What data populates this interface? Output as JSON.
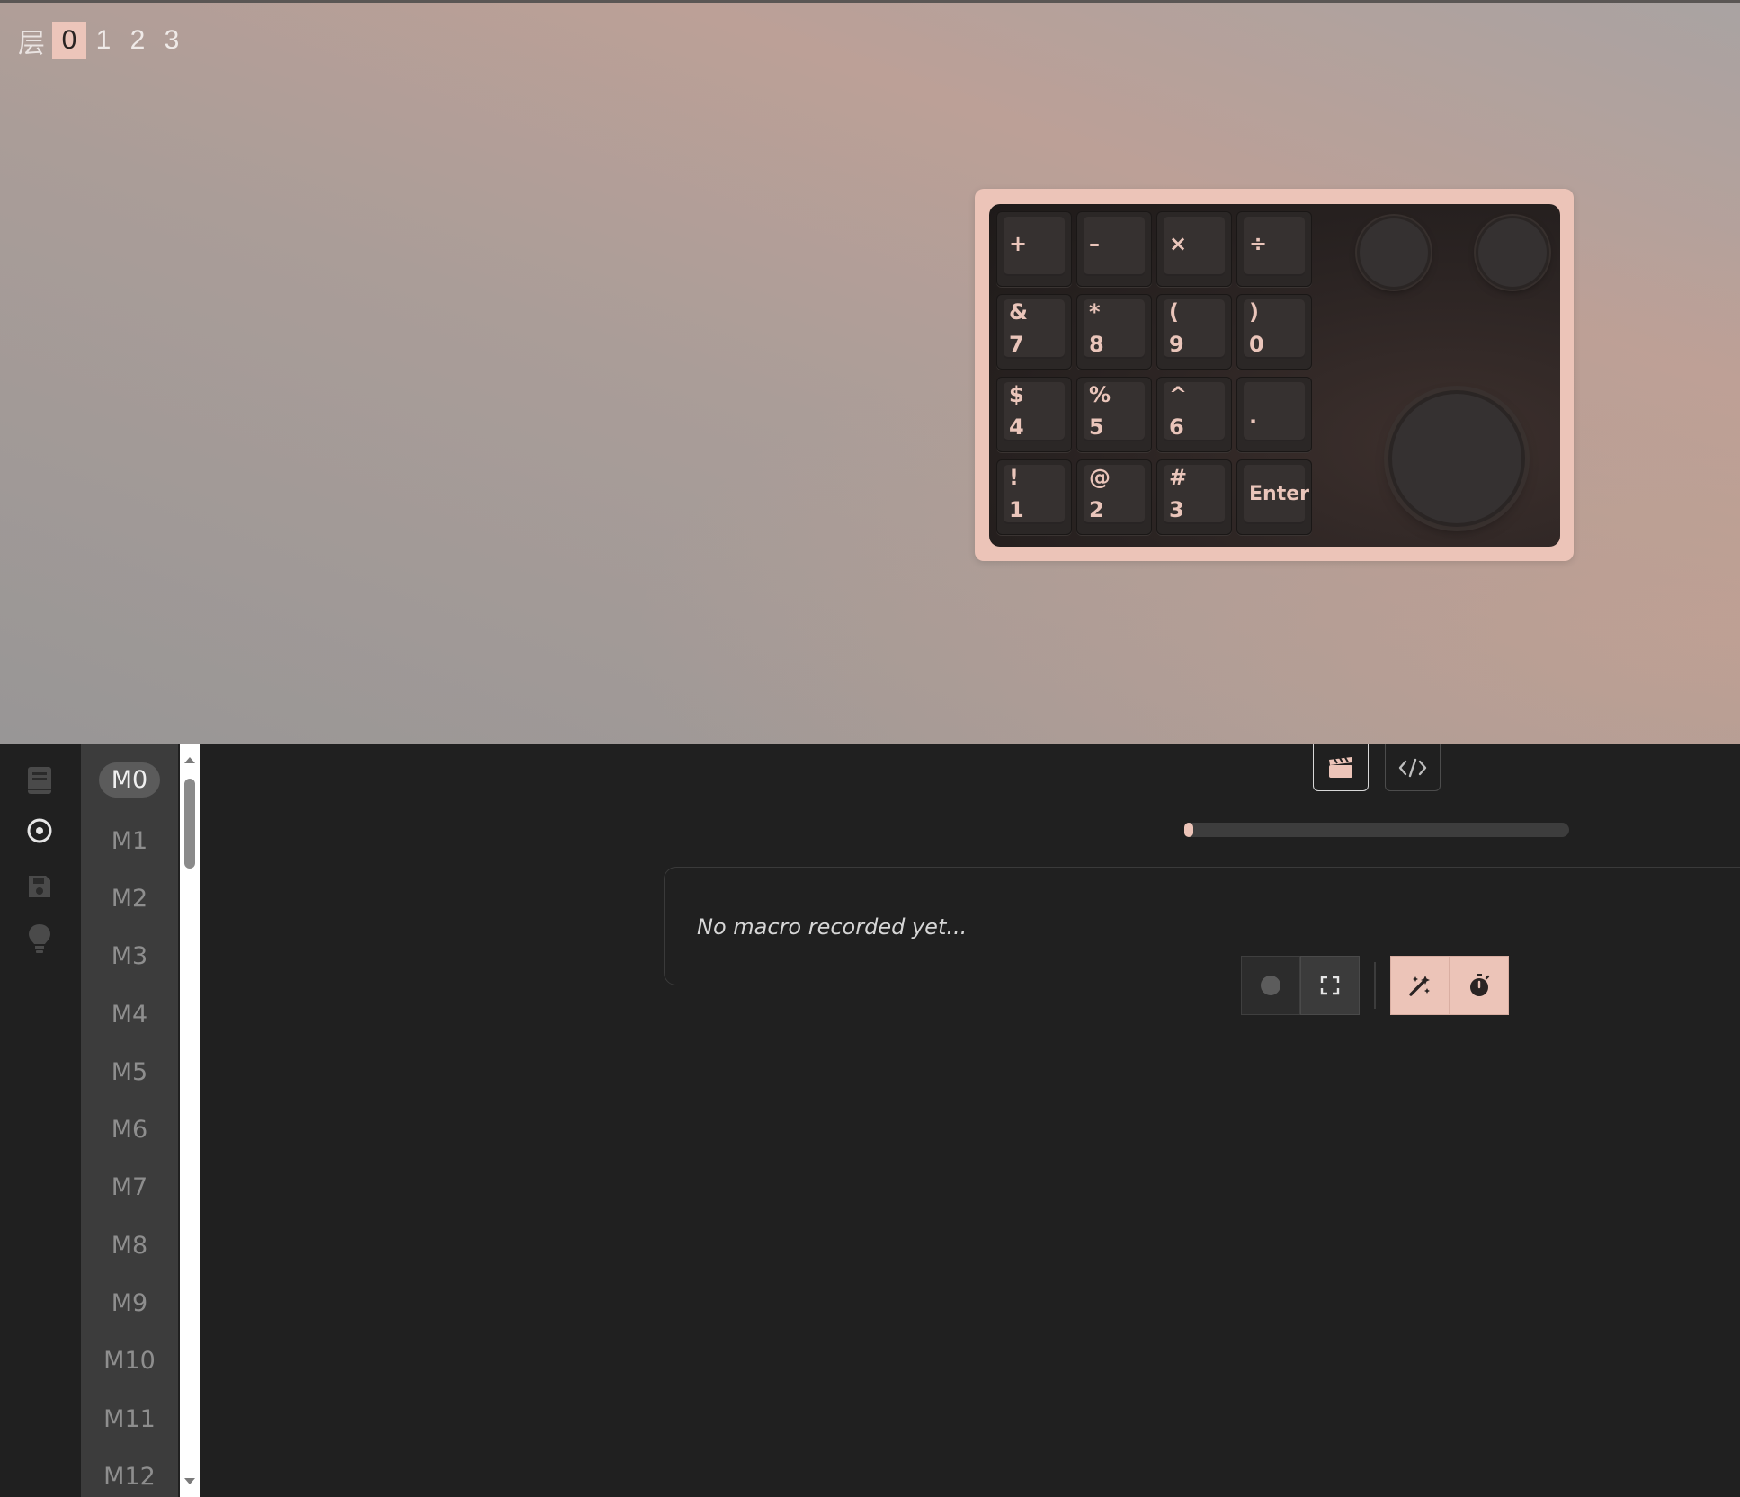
{
  "layers": {
    "label": "层",
    "items": [
      "0",
      "1",
      "2",
      "3"
    ],
    "active": "0"
  },
  "keyboard": {
    "rows": [
      [
        {
          "top": "+",
          "bottom": ""
        },
        {
          "top": "–",
          "bottom": ""
        },
        {
          "top": "×",
          "bottom": ""
        },
        {
          "top": "÷",
          "bottom": ""
        }
      ],
      [
        {
          "top": "&",
          "bottom": "7"
        },
        {
          "top": "*",
          "bottom": "8"
        },
        {
          "top": "(",
          "bottom": "9"
        },
        {
          "top": ")",
          "bottom": "0"
        }
      ],
      [
        {
          "top": "$",
          "bottom": "4"
        },
        {
          "top": "%",
          "bottom": "5"
        },
        {
          "top": "^",
          "bottom": "6"
        },
        {
          "top": "",
          "bottom": "."
        }
      ],
      [
        {
          "top": "!",
          "bottom": "1"
        },
        {
          "top": "@",
          "bottom": "2"
        },
        {
          "top": "#",
          "bottom": "3"
        },
        {
          "top": "Enter",
          "bottom": ""
        }
      ]
    ],
    "knobs": [
      "small-knob-left",
      "small-knob-right",
      "large-knob"
    ]
  },
  "sidebar": {
    "icons": [
      "book-icon",
      "target-icon",
      "save-icon",
      "lightbulb-icon"
    ],
    "active": "target-icon"
  },
  "macros": {
    "items": [
      "M0",
      "M1",
      "M2",
      "M3",
      "M4",
      "M5",
      "M6",
      "M7",
      "M8",
      "M9",
      "M10",
      "M11",
      "M12"
    ],
    "active": "M0"
  },
  "toolbar": {
    "icons": [
      "clapperboard-icon",
      "code-icon"
    ]
  },
  "progress": {
    "value": 0
  },
  "macro_panel": {
    "empty_text": "No macro recorded yet..."
  },
  "controls": {
    "icons": [
      "record-icon",
      "fullscreen-icon",
      "magic-wand-icon",
      "stopwatch-icon"
    ]
  },
  "colors": {
    "accent": "#ecc4b8",
    "panel_bg": "#202020",
    "list_bg": "#3c3c3c",
    "key_legend": "#eac5ba"
  }
}
